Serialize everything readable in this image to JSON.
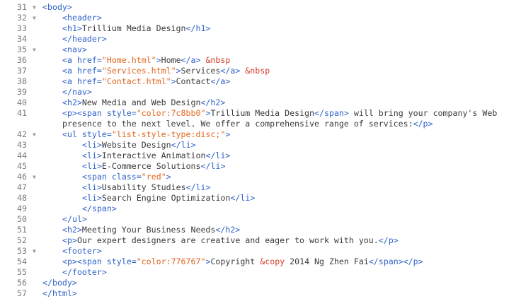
{
  "editor": {
    "lines": [
      {
        "n": "31",
        "fold": true,
        "indent": 0,
        "tokens": [
          {
            "t": "tag",
            "v": "<body>"
          }
        ]
      },
      {
        "n": "32",
        "fold": true,
        "indent": 1,
        "tokens": [
          {
            "t": "tag",
            "v": "<header>"
          }
        ]
      },
      {
        "n": "33",
        "fold": false,
        "indent": 1,
        "tokens": [
          {
            "t": "tag",
            "v": "<h1>"
          },
          {
            "t": "text",
            "v": "Trillium Media Design"
          },
          {
            "t": "tag",
            "v": "</h1>"
          }
        ]
      },
      {
        "n": "34",
        "fold": false,
        "indent": 1,
        "tokens": [
          {
            "t": "tag",
            "v": "</header>"
          }
        ]
      },
      {
        "n": "35",
        "fold": true,
        "indent": 1,
        "tokens": [
          {
            "t": "tag",
            "v": "<nav>"
          }
        ]
      },
      {
        "n": "36",
        "fold": false,
        "indent": 1,
        "tokens": [
          {
            "t": "tag",
            "v": "<a "
          },
          {
            "t": "attr",
            "v": "href="
          },
          {
            "t": "val",
            "v": "\"Home.html\""
          },
          {
            "t": "tag",
            "v": ">"
          },
          {
            "t": "text",
            "v": "Home"
          },
          {
            "t": "tag",
            "v": "</a>"
          },
          {
            "t": "text",
            "v": " "
          },
          {
            "t": "ent",
            "v": "&nbsp"
          }
        ]
      },
      {
        "n": "37",
        "fold": false,
        "indent": 1,
        "tokens": [
          {
            "t": "tag",
            "v": "<a "
          },
          {
            "t": "attr",
            "v": "href="
          },
          {
            "t": "val",
            "v": "\"Services.html\""
          },
          {
            "t": "tag",
            "v": ">"
          },
          {
            "t": "text",
            "v": "Services"
          },
          {
            "t": "tag",
            "v": "</a>"
          },
          {
            "t": "text",
            "v": " "
          },
          {
            "t": "ent",
            "v": "&nbsp"
          }
        ]
      },
      {
        "n": "38",
        "fold": false,
        "indent": 1,
        "tokens": [
          {
            "t": "tag",
            "v": "<a "
          },
          {
            "t": "attr",
            "v": "href="
          },
          {
            "t": "val",
            "v": "\"Contact.html\""
          },
          {
            "t": "tag",
            "v": ">"
          },
          {
            "t": "text",
            "v": "Contact"
          },
          {
            "t": "tag",
            "v": "</a>"
          }
        ]
      },
      {
        "n": "39",
        "fold": false,
        "indent": 1,
        "tokens": [
          {
            "t": "tag",
            "v": "</nav>"
          }
        ]
      },
      {
        "n": "40",
        "fold": false,
        "indent": 1,
        "tokens": [
          {
            "t": "tag",
            "v": "<h2>"
          },
          {
            "t": "text",
            "v": "New Media and Web Design"
          },
          {
            "t": "tag",
            "v": "</h2>"
          }
        ]
      },
      {
        "n": "41",
        "fold": false,
        "indent": 1,
        "wrap": true,
        "tokens": [
          {
            "t": "tag",
            "v": "<p><span "
          },
          {
            "t": "attr",
            "v": "style="
          },
          {
            "t": "val",
            "v": "\"color:7c8bb0\""
          },
          {
            "t": "tag",
            "v": ">"
          },
          {
            "t": "text",
            "v": "Trillium Media Design"
          },
          {
            "t": "tag",
            "v": "</span>"
          },
          {
            "t": "text",
            "v": " will bring your company's Web presence to the next level. We offer a comprehensive range of services:"
          },
          {
            "t": "tag",
            "v": "</p>"
          }
        ]
      },
      {
        "n": "42",
        "fold": true,
        "indent": 1,
        "tokens": [
          {
            "t": "tag",
            "v": "<ul "
          },
          {
            "t": "attr",
            "v": "style="
          },
          {
            "t": "val",
            "v": "\"list-style-type:disc;\""
          },
          {
            "t": "tag",
            "v": ">"
          }
        ]
      },
      {
        "n": "43",
        "fold": false,
        "indent": 2,
        "tokens": [
          {
            "t": "tag",
            "v": "<li>"
          },
          {
            "t": "text",
            "v": "Website Design"
          },
          {
            "t": "tag",
            "v": "</li>"
          }
        ]
      },
      {
        "n": "44",
        "fold": false,
        "indent": 2,
        "tokens": [
          {
            "t": "tag",
            "v": "<li>"
          },
          {
            "t": "text",
            "v": "Interactive Animation"
          },
          {
            "t": "tag",
            "v": "</li>"
          }
        ]
      },
      {
        "n": "45",
        "fold": false,
        "indent": 2,
        "tokens": [
          {
            "t": "tag",
            "v": "<li>"
          },
          {
            "t": "text",
            "v": "E-Commerce Solutions"
          },
          {
            "t": "tag",
            "v": "</li>"
          }
        ]
      },
      {
        "n": "46",
        "fold": true,
        "indent": 2,
        "tokens": [
          {
            "t": "tag",
            "v": "<span "
          },
          {
            "t": "attr",
            "v": "class="
          },
          {
            "t": "val",
            "v": "\"red\""
          },
          {
            "t": "tag",
            "v": ">"
          }
        ]
      },
      {
        "n": "47",
        "fold": false,
        "indent": 2,
        "tokens": [
          {
            "t": "tag",
            "v": "<li>"
          },
          {
            "t": "text",
            "v": "Usability Studies"
          },
          {
            "t": "tag",
            "v": "</li>"
          }
        ]
      },
      {
        "n": "48",
        "fold": false,
        "indent": 2,
        "tokens": [
          {
            "t": "tag",
            "v": "<li>"
          },
          {
            "t": "text",
            "v": "Search Engine Optimization"
          },
          {
            "t": "tag",
            "v": "</li>"
          }
        ]
      },
      {
        "n": "49",
        "fold": false,
        "indent": 2,
        "tokens": [
          {
            "t": "tag",
            "v": "</span>"
          }
        ]
      },
      {
        "n": "50",
        "fold": false,
        "indent": 1,
        "tokens": [
          {
            "t": "tag",
            "v": "</ul>"
          }
        ]
      },
      {
        "n": "51",
        "fold": false,
        "indent": 1,
        "tokens": [
          {
            "t": "tag",
            "v": "<h2>"
          },
          {
            "t": "text",
            "v": "Meeting Your Business Needs"
          },
          {
            "t": "tag",
            "v": "</h2>"
          }
        ]
      },
      {
        "n": "52",
        "fold": false,
        "indent": 1,
        "tokens": [
          {
            "t": "tag",
            "v": "<p>"
          },
          {
            "t": "text",
            "v": "Our expert designers are creative and eager to work with you."
          },
          {
            "t": "tag",
            "v": "</p>"
          }
        ]
      },
      {
        "n": "53",
        "fold": true,
        "indent": 1,
        "tokens": [
          {
            "t": "tag",
            "v": "<footer>"
          }
        ]
      },
      {
        "n": "54",
        "fold": false,
        "indent": 1,
        "tokens": [
          {
            "t": "tag",
            "v": "<p><span "
          },
          {
            "t": "attr",
            "v": "style="
          },
          {
            "t": "val",
            "v": "\"color:776767\""
          },
          {
            "t": "tag",
            "v": ">"
          },
          {
            "t": "text",
            "v": "Copyright "
          },
          {
            "t": "ent",
            "v": "&copy"
          },
          {
            "t": "text",
            "v": " 2014 Ng Zhen Fai"
          },
          {
            "t": "tag",
            "v": "</span></p>"
          }
        ]
      },
      {
        "n": "55",
        "fold": false,
        "indent": 1,
        "tokens": [
          {
            "t": "tag",
            "v": "</footer>"
          }
        ]
      },
      {
        "n": "56",
        "fold": false,
        "indent": 0,
        "tokens": [
          {
            "t": "tag",
            "v": "</body>"
          }
        ]
      },
      {
        "n": "57",
        "fold": false,
        "indent": 0,
        "tokens": [
          {
            "t": "tag",
            "v": "</html>"
          }
        ]
      }
    ]
  }
}
